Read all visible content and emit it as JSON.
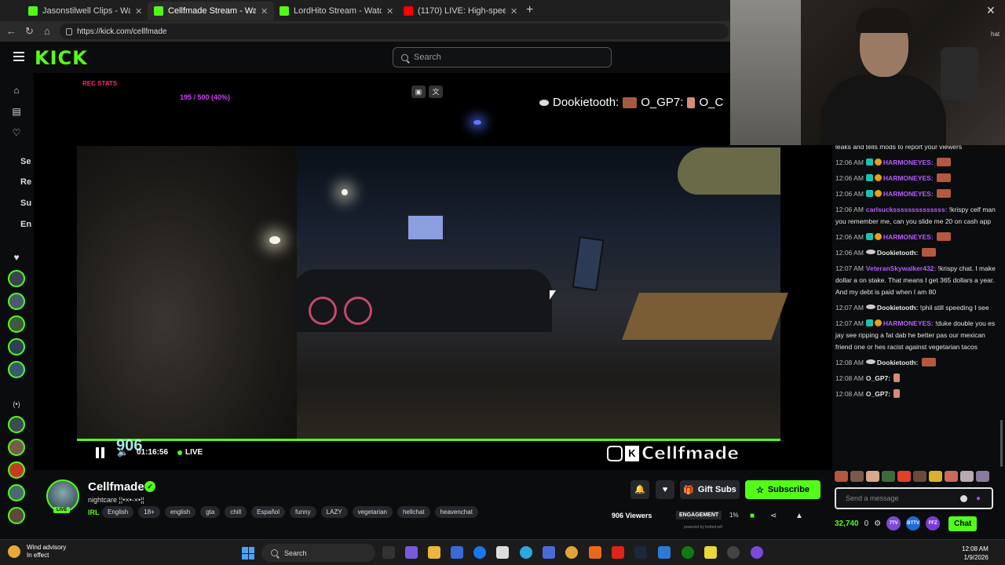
{
  "browser": {
    "tabs": [
      {
        "title": "Jasonstilwell Clips - Watch Live on",
        "icon": "kick-favicon"
      },
      {
        "title": "Cellfmade Stream - Watch Live",
        "icon": "kick-favicon",
        "active": true
      },
      {
        "title": "LordHito Stream - Watch Live",
        "icon": "kick-favicon"
      },
      {
        "title": "(1170) LIVE: High-speed p",
        "icon": "youtube-favicon"
      }
    ],
    "url": "https://kick.com/cellfmade"
  },
  "header": {
    "logo": "KICK",
    "search_placeholder": "Search"
  },
  "sidebar": {
    "labels": [
      "Se",
      "Re",
      "Su",
      "En"
    ]
  },
  "video": {
    "overlay_goal": "195 / 500 (40%)",
    "overlay_red": "REC STATS",
    "ticker_user1": "Dookietooth:",
    "ticker_user2": "O_GP7:",
    "ticker_user3": "O_C",
    "viewer_count_overlay": "906",
    "time": "01:16:56",
    "live_label": "LIVE",
    "brand_name": "Cellfmade",
    "progress_fraction": 1.0
  },
  "webcam": {
    "chat_label": "hat"
  },
  "chat": {
    "messages": [
      {
        "time": "",
        "user": "",
        "text": "leaks and tells mods to report your viewers",
        "color": "#e6e6e6"
      },
      {
        "time": "12:06 AM",
        "user": "HARMONEYES:",
        "text": "",
        "color": "#b55cff",
        "badges": "subgift",
        "emote": true
      },
      {
        "time": "12:06 AM",
        "user": "HARMONEYES:",
        "text": "",
        "color": "#b55cff",
        "badges": "subgift",
        "emote": true
      },
      {
        "time": "12:06 AM",
        "user": "HARMONEYES:",
        "text": "",
        "color": "#b55cff",
        "badges": "subgift",
        "emote": true
      },
      {
        "time": "12:06 AM",
        "user": "carlsuckssssssssssssss:",
        "text": "!krispy celf man you remember me, can you slide me 20 on cash app",
        "color": "#b55cff"
      },
      {
        "time": "12:06 AM",
        "user": "HARMONEYES:",
        "text": "",
        "color": "#b55cff",
        "badges": "subgift",
        "emote": true
      },
      {
        "time": "12:06 AM",
        "user": "Dookietooth:",
        "text": "",
        "color": "#e6e6e6",
        "badges": "mod",
        "emote": true
      },
      {
        "time": "12:07 AM",
        "user": "VeteranSkywalker432:",
        "text": "!krispy chat. I make dollar a on stake. That means I get 365 dollars a year. And my debt is paid when I am 80",
        "color": "#b55cff"
      },
      {
        "time": "12:07 AM",
        "user": "Dookietooth:",
        "text": "!phil still speeding I see",
        "color": "#e6e6e6",
        "badges": "mod"
      },
      {
        "time": "12:07 AM",
        "user": "HARMONEYES:",
        "text": "!duke double you es jay see ripping a fat dab he better pas our mexican friend one or hes racist against vegetarian tacos",
        "color": "#b55cff",
        "badges": "subgift"
      },
      {
        "time": "12:08 AM",
        "user": "Dookietooth:",
        "text": "",
        "color": "#e6e6e6",
        "badges": "mod",
        "emote": true
      },
      {
        "time": "12:08 AM",
        "user": "O_GP7:",
        "text": "",
        "color": "#e6e6e6",
        "emote_pink": true
      },
      {
        "time": "12:08 AM",
        "user": "O_GP7:",
        "text": "",
        "color": "#e6e6e6",
        "emote_pink": true
      }
    ],
    "input_placeholder": "Send a message",
    "points": "32,740",
    "zero_count": "0",
    "ttv_label": "7TV",
    "bttv_label": "BTTV",
    "ffz_label": "FFZ",
    "chat_button": "Chat"
  },
  "streamer": {
    "name": "Cellfmade",
    "title": "nightcare ¦¦•×•-×•¦¦",
    "live_badge": "LIVE",
    "category": "IRL",
    "tags": [
      "English",
      "18+",
      "english",
      "gta",
      "chill",
      "Español",
      "funny",
      "LAZY",
      "vegetarian",
      "hellchat",
      "heavenchat"
    ],
    "gift_label": "Gift Subs",
    "subscribe_label": "Subscribe",
    "viewers_label": "906 Viewers",
    "engagement_label": "ENGAGEMENT",
    "engagement_pct": "1%",
    "powered_by": "powered by botted.wtf"
  },
  "taskbar": {
    "weather_line1": "Wind advisory",
    "weather_line2": "In effect",
    "search_label": "Search",
    "time": "12:08 AM",
    "date": "1/9/2026"
  },
  "colors": {
    "kick_green": "#53fc18",
    "chat_purple": "#b55cff",
    "background": "#0b0c0d"
  }
}
